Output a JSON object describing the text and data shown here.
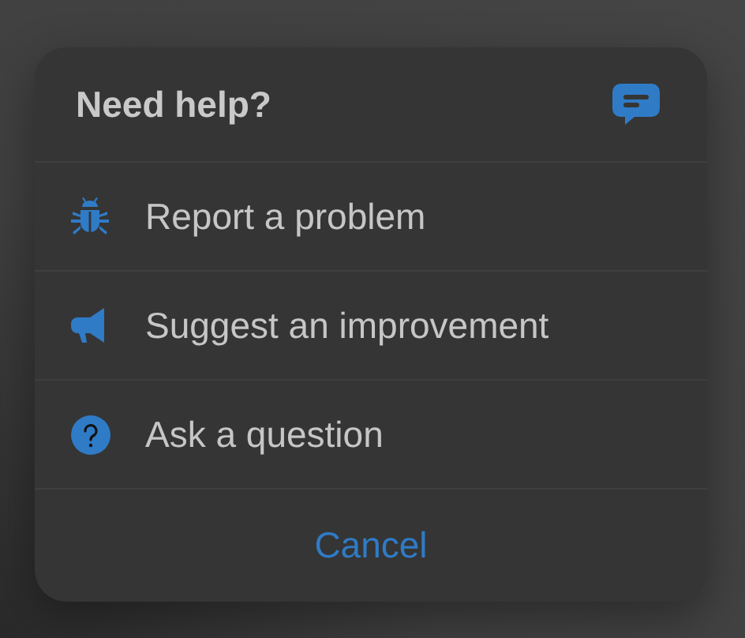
{
  "dialog": {
    "title": "Need help?"
  },
  "items": [
    {
      "kind": "bug",
      "label": "Report a problem"
    },
    {
      "kind": "megaphone",
      "label": "Suggest an improvement"
    },
    {
      "kind": "question",
      "label": "Ask a question"
    }
  ],
  "cancel": "Cancel"
}
